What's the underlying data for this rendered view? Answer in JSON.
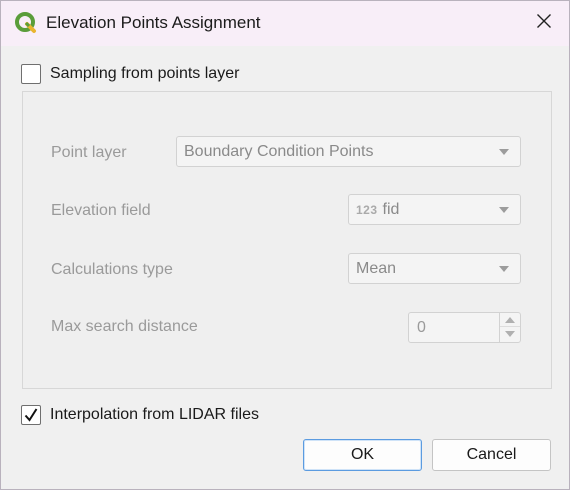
{
  "window": {
    "title": "Elevation Points Assignment",
    "app_icon": "qgis-logo-icon",
    "close_icon": "close-icon"
  },
  "sampling": {
    "label": "Sampling from points layer",
    "checked": false
  },
  "form": {
    "point_layer": {
      "label": "Point layer",
      "value": "Boundary Condition Points"
    },
    "elevation_field": {
      "label": "Elevation field",
      "type_badge": "123",
      "value": "fid"
    },
    "calculations_type": {
      "label": "Calculations type",
      "value": "Mean"
    },
    "max_search_distance": {
      "label": "Max search distance",
      "value": "0"
    }
  },
  "interpolation": {
    "label": "Interpolation from LIDAR files",
    "checked": true
  },
  "buttons": {
    "ok": "OK",
    "cancel": "Cancel"
  },
  "colors": {
    "titlebar_bg": "#f8eef8",
    "default_button_border": "#5b9be0",
    "disabled_text": "#9a9a9a"
  }
}
